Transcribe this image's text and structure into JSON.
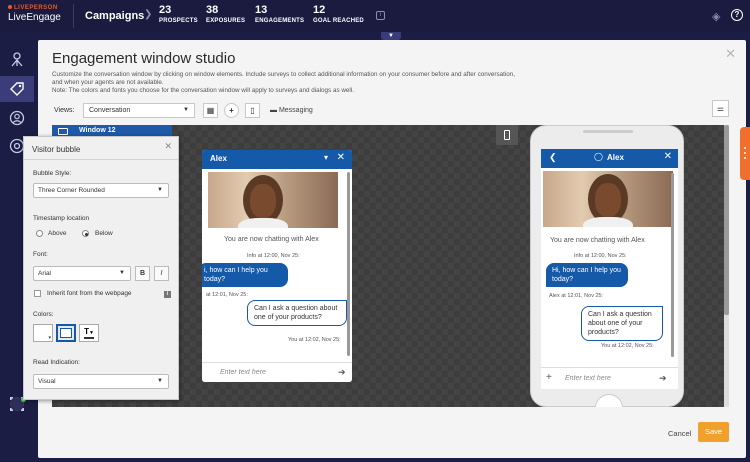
{
  "brand": {
    "top": "LIVEPERSON",
    "name": "LiveEngage"
  },
  "nav": {
    "campaigns": "Campaigns",
    "stats": [
      {
        "value": "23",
        "label": "PROSPECTS"
      },
      {
        "value": "38",
        "label": "EXPOSURES"
      },
      {
        "value": "13",
        "label": "ENGAGEMENTS"
      },
      {
        "value": "12",
        "label": "GOAL REACHED"
      }
    ]
  },
  "panel": {
    "title": "Engagement window studio",
    "desc1": "Customize the conversation window by clicking on window elements. Include surveys to collect additional information on your consumer before and after conversation,",
    "desc2": "and when your agents are not available.",
    "desc3": "Note: The colors and fonts you choose for the conversation window will apply to surveys and dialogs as well.",
    "views_label": "Views:",
    "views_value": "Conversation",
    "messaging": "Messaging",
    "cancel": "Cancel",
    "save": "Save"
  },
  "window_tag": "Window 12",
  "engagement": {
    "agent_name": "Alex",
    "chatting": "You are now chatting with Alex",
    "info_time": "Info at 12:00, Nov 25:",
    "agent_msg": "Hi, how can I help you today?",
    "agent_msg_left": "i, how can I help you today?",
    "agent_meta": "Alex at 12:01, Nov 25:",
    "agent_meta_left": "at 12:01, Nov 25:",
    "visitor_msg": "Can I ask a question about one of your products?",
    "visitor_meta": "You at 12:02, Nov 25:",
    "input_placeholder": "Enter text here"
  },
  "visitor_bubble": {
    "title": "Visitor bubble",
    "bubble_style_label": "Bubble Style:",
    "bubble_style_value": "Three Corner Rounded",
    "timestamp_label": "Timestamp location",
    "above": "Above",
    "below": "Below",
    "font_label": "Font:",
    "font_value": "Arial",
    "bold": "B",
    "italic": "I",
    "inherit": "Inherit font from the webpage",
    "colors_label": "Colors:",
    "read_label": "Read Indication:",
    "read_value": "Visual",
    "text_color_glyph": "T"
  },
  "colors": {
    "accent": "#1559a9",
    "save": "#f0a02c",
    "nav_bg": "#1a1b3e"
  }
}
